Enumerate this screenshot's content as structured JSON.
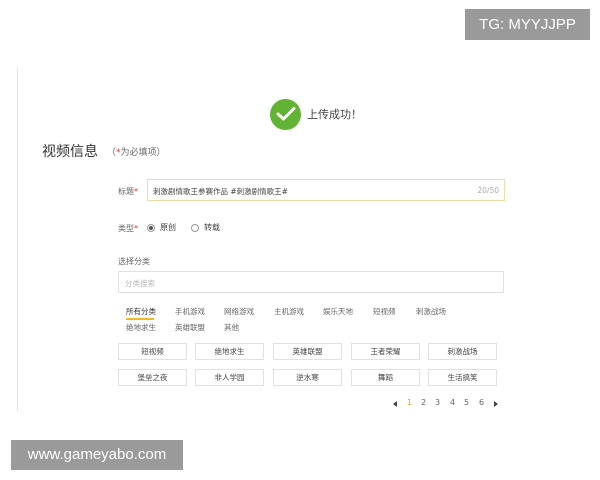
{
  "watermarks": {
    "tg": "TG: MYYJJPP",
    "site": "www.gameyabo.com"
  },
  "colors": {
    "success_green": "#62b233",
    "accent_yellow": "#f0b92a",
    "required_red": "#e0302b"
  },
  "upload": {
    "status_text": "上传成功！",
    "status_icon": "check-circle-icon"
  },
  "section": {
    "title": "视频信息",
    "hint_prefix": "（",
    "hint_star": "*",
    "hint_text": "为必填项）"
  },
  "form": {
    "title_label": "标题",
    "required_mark": "*",
    "title_value": "刺激剧情歌王参赛作品 #刺激剧情歌王#",
    "title_count": "20/50",
    "type_label": "类型",
    "type_options": [
      {
        "label": "原创",
        "selected": true
      },
      {
        "label": "转载",
        "selected": false
      }
    ],
    "category_label": "选择分类",
    "category_search_placeholder": "分类搜索"
  },
  "category_tabs": [
    "所有分类",
    "手机游戏",
    "网络游戏",
    "主机游戏",
    "娱乐天地",
    "短视频",
    "刺激战场",
    "绝地求生",
    "英雄联盟",
    "其他"
  ],
  "active_tab": "所有分类",
  "category_buttons": [
    "短视频",
    "绝地求生",
    "英雄联盟",
    "王者荣耀",
    "刺激战场",
    "堡垒之夜",
    "非人学园",
    "逆水寒",
    "舞蹈",
    "生活搞笑"
  ],
  "pagination": {
    "pages": [
      "1",
      "2",
      "3",
      "4",
      "5",
      "6"
    ],
    "current": "1"
  }
}
